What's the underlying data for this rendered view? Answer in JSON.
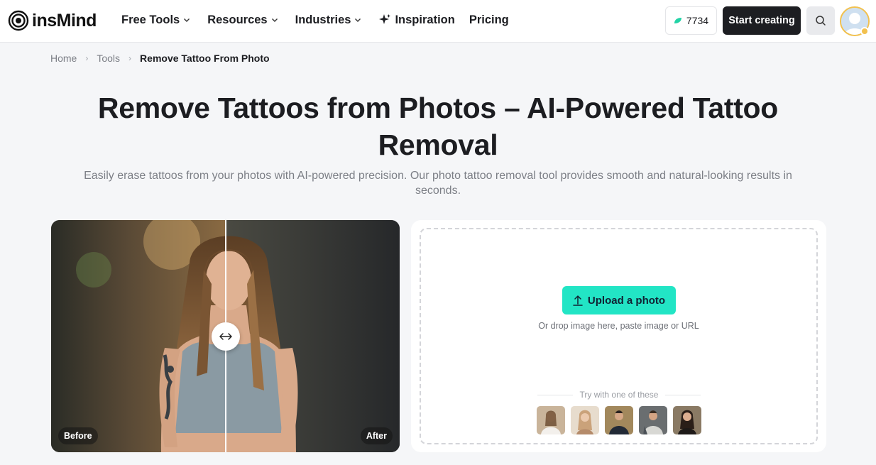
{
  "header": {
    "logo_text": "insMind",
    "nav": [
      {
        "label": "Free Tools",
        "dropdown": true
      },
      {
        "label": "Resources",
        "dropdown": true
      },
      {
        "label": "Industries",
        "dropdown": true
      },
      {
        "label": "Inspiration",
        "dropdown": false,
        "icon": "sparkle-icon"
      },
      {
        "label": "Pricing",
        "dropdown": false
      }
    ],
    "credits": "7734",
    "start_label": "Start creating"
  },
  "breadcrumb": {
    "items": [
      "Home",
      "Tools"
    ],
    "current": "Remove Tattoo From Photo"
  },
  "hero": {
    "title": "Remove Tattoos from Photos – AI-Powered Tattoo Removal",
    "subtitle": "Easily erase tattoos from your photos with AI-powered precision. Our photo tattoo removal tool provides smooth and natural-looking results in seconds."
  },
  "compare": {
    "before_label": "Before",
    "after_label": "After"
  },
  "upload": {
    "button_label": "Upload a photo",
    "hint": "Or drop image here, paste image or URL",
    "try_label": "Try with one of these",
    "sample_count": 5
  },
  "colors": {
    "accent": "#22e5c5",
    "dark": "#1d1e22",
    "page_bg": "#f5f6f8"
  }
}
